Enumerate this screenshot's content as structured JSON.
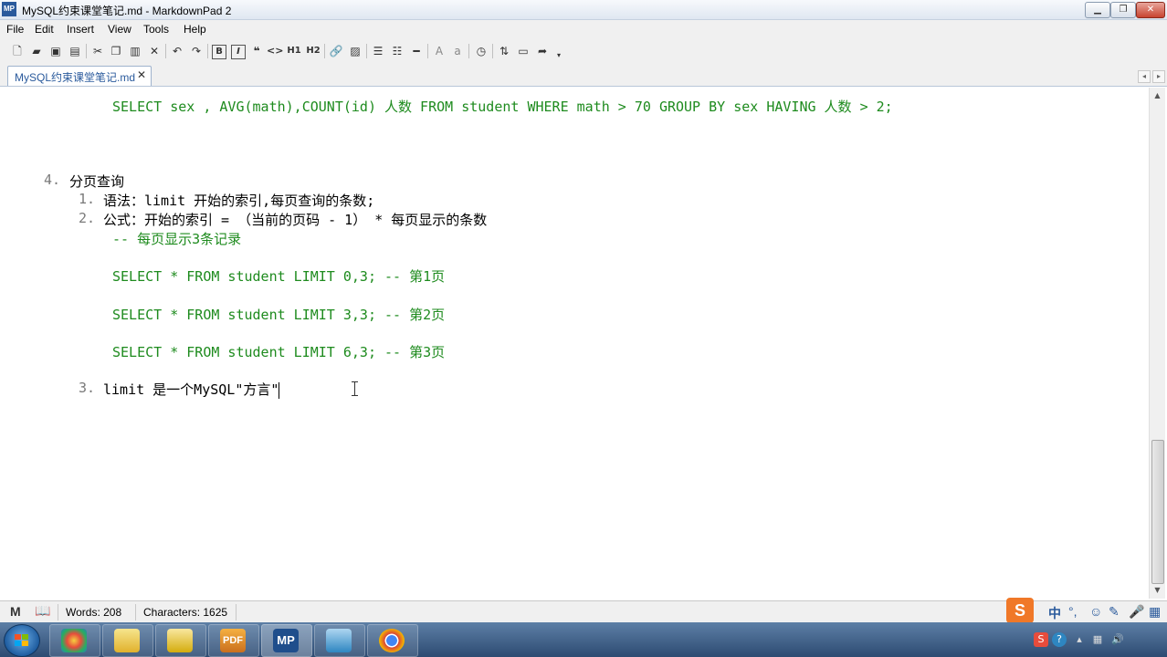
{
  "window": {
    "title": "MySQL约束课堂笔记.md - MarkdownPad 2",
    "app_icon_text": "MP",
    "minimize": "▁",
    "maximize": "❐",
    "close": "✕"
  },
  "menu": [
    "File",
    "Edit",
    "Insert",
    "View",
    "Tools",
    "Help"
  ],
  "toolbar": {
    "bold": "B",
    "italic": "I",
    "quote": "❝",
    "code": "<>",
    "h1": "H1",
    "h2": "H2",
    "font_larger": "A",
    "font_smaller": "a"
  },
  "tab": {
    "label": "MySQL约束课堂笔记.md",
    "close": "✕"
  },
  "editor": {
    "line1": "SELECT sex , AVG(math),COUNT(id) 人数 FROM student WHERE math > 70 GROUP BY sex HAVING 人数 > 2;",
    "item4_num": "4.",
    "item4_text": "分页查询",
    "sub1_num": "1.",
    "sub1_text": "语法：limit 开始的索引,每页查询的条数;",
    "sub2_num": "2.",
    "sub2_text": "公式：开始的索引 = （当前的页码 - 1） * 每页显示的条数",
    "comment": "-- 每页显示3条记录",
    "sql1": "SELECT * FROM student LIMIT 0,3; -- 第1页",
    "sql2": "SELECT * FROM student LIMIT 3,3; -- 第2页",
    "sql3": "SELECT * FROM student LIMIT 6,3; -- 第3页",
    "sub3_num": "3.",
    "sub3_text": "limit 是一个MySQL\"方言\""
  },
  "status": {
    "words": "Words: 208",
    "characters": "Characters: 1625"
  },
  "ime": {
    "logo": "S",
    "lang": "中"
  },
  "colors": {
    "code_green": "#1e8b1e",
    "list_number_gray": "#7a7a7a",
    "accent_blue": "#2a5a9c"
  }
}
